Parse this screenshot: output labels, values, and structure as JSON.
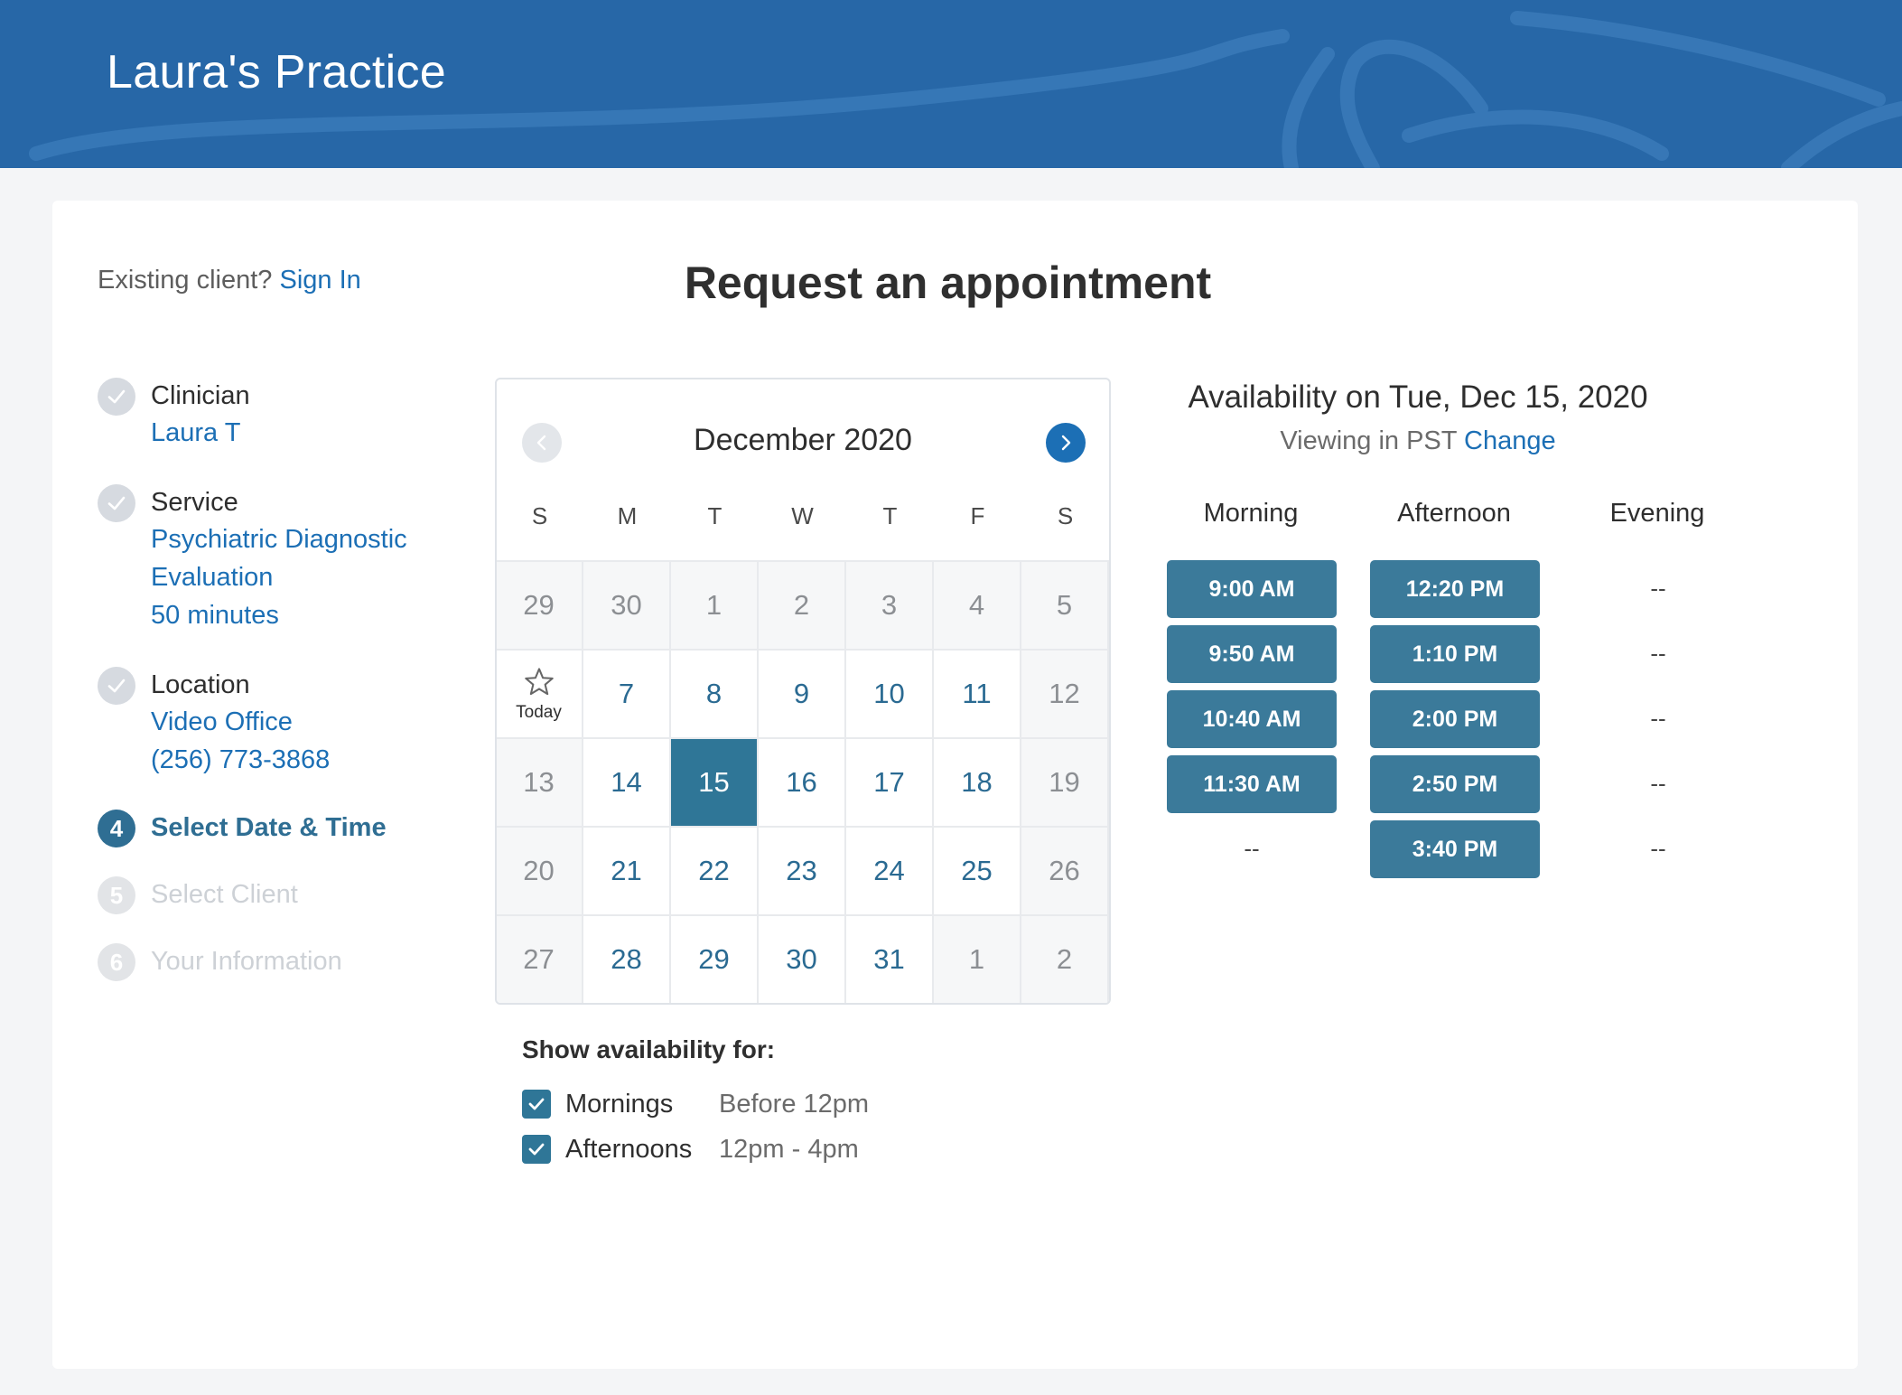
{
  "header": {
    "practice_name": "Laura's Practice"
  },
  "page": {
    "existing_client_prompt": "Existing client?",
    "sign_in_link": "Sign In",
    "title": "Request an appointment"
  },
  "steps": [
    {
      "number": "",
      "title": "Clinician",
      "details": [
        "Laura T"
      ],
      "state": "done"
    },
    {
      "number": "",
      "title": "Service",
      "details": [
        "Psychiatric Diagnostic",
        "Evaluation",
        "50 minutes"
      ],
      "state": "done"
    },
    {
      "number": "",
      "title": "Location",
      "details": [
        "Video Office",
        "(256) 773-3868"
      ],
      "state": "done"
    },
    {
      "number": "4",
      "title": "Select Date & Time",
      "details": [],
      "state": "active"
    },
    {
      "number": "5",
      "title": "Select Client",
      "details": [],
      "state": "pending"
    },
    {
      "number": "6",
      "title": "Your Information",
      "details": [],
      "state": "pending"
    }
  ],
  "calendar": {
    "month_label": "December 2020",
    "weekdays": [
      "S",
      "M",
      "T",
      "W",
      "T",
      "F",
      "S"
    ],
    "today_label": "Today",
    "weeks": [
      [
        "29",
        "30",
        "1",
        "2",
        "3",
        "4",
        "5"
      ],
      [
        "",
        "7",
        "8",
        "9",
        "10",
        "11",
        "12"
      ],
      [
        "13",
        "14",
        "15",
        "16",
        "17",
        "18",
        "19"
      ],
      [
        "20",
        "21",
        "22",
        "23",
        "24",
        "25",
        "26"
      ],
      [
        "27",
        "28",
        "29",
        "30",
        "31",
        "1",
        "2"
      ]
    ],
    "day_states": [
      [
        "muted",
        "muted",
        "muted",
        "muted",
        "muted",
        "muted",
        "muted"
      ],
      [
        "today",
        "available",
        "available",
        "available",
        "available",
        "available",
        "weekend"
      ],
      [
        "weekend",
        "available",
        "selected",
        "available",
        "available",
        "available",
        "weekend"
      ],
      [
        "weekend",
        "available",
        "available",
        "available",
        "available",
        "available",
        "weekend"
      ],
      [
        "weekend",
        "available",
        "available",
        "available",
        "available",
        "muted",
        "muted"
      ]
    ]
  },
  "filters": {
    "title": "Show availability for:",
    "options": [
      {
        "name": "Mornings",
        "range": "Before 12pm",
        "checked": true
      },
      {
        "name": "Afternoons",
        "range": "12pm - 4pm",
        "checked": true
      }
    ]
  },
  "availability": {
    "title": "Availability on Tue, Dec 15, 2020",
    "timezone_prefix": "Viewing in PST",
    "change_link": "Change",
    "periods": [
      {
        "label": "Morning",
        "slots": [
          "9:00 AM",
          "9:50 AM",
          "10:40 AM",
          "11:30 AM",
          "--"
        ]
      },
      {
        "label": "Afternoon",
        "slots": [
          "12:20 PM",
          "1:10 PM",
          "2:00 PM",
          "2:50 PM",
          "3:40 PM"
        ]
      },
      {
        "label": "Evening",
        "slots": [
          "--",
          "--",
          "--",
          "--",
          "--"
        ]
      }
    ]
  },
  "colors": {
    "header_bg": "#2767a7",
    "accent_link": "#1c6fb5",
    "selected_day": "#2f7697",
    "slot_button": "#3b7a9a"
  }
}
